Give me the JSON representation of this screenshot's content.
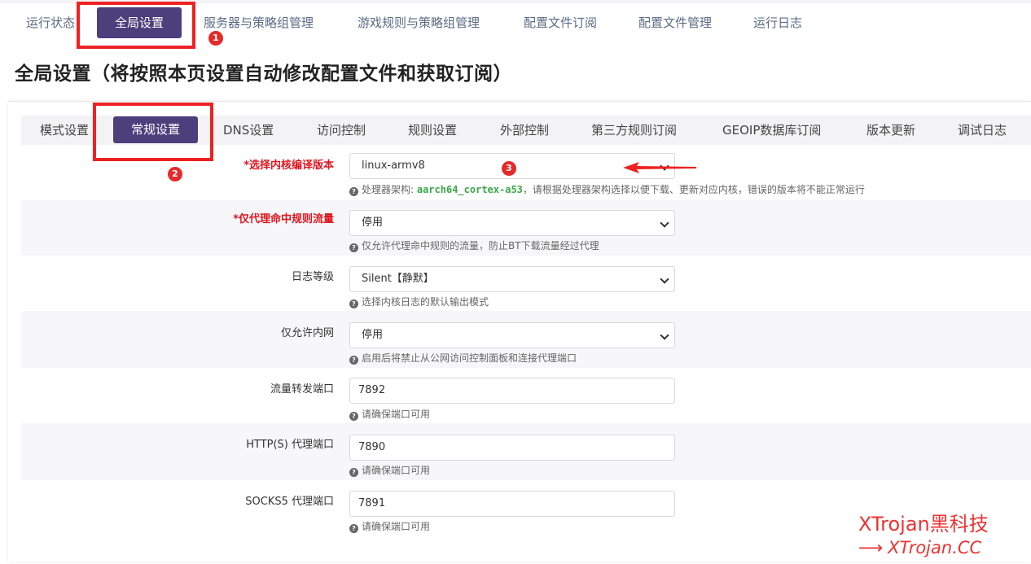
{
  "top_nav": {
    "tabs": [
      "运行状态",
      "全局设置",
      "服务器与策略组管理",
      "游戏规则与策略组管理",
      "配置文件订阅",
      "配置文件管理",
      "运行日志"
    ],
    "active": "全局设置"
  },
  "page_title": "全局设置（将按照本页设置自动修改配置文件和获取订阅）",
  "sub_nav": {
    "tabs": [
      "模式设置",
      "常规设置",
      "DNS设置",
      "访问控制",
      "规则设置",
      "外部控制",
      "第三方规则订阅",
      "GEOIP数据库订阅",
      "版本更新",
      "调试日志"
    ],
    "active": "常规设置"
  },
  "form": {
    "core_version": {
      "label": "*选择内核编译版本",
      "value": "linux-armv8",
      "help_prefix": "处理器架构: ",
      "help_arch": "aarch64_cortex-a53",
      "help_suffix": "，请根据处理器架构选择以便下载、更新对应内核，错误的版本将不能正常运行"
    },
    "proxy_rule_only": {
      "label": "*仅代理命中规则流量",
      "value": "停用",
      "help": "仅允许代理命中规则的流量，防止BT下载流量经过代理"
    },
    "log_level": {
      "label": "日志等级",
      "value": "Silent【静默】",
      "help": "选择内核日志的默认输出模式"
    },
    "lan_only": {
      "label": "仅允许内网",
      "value": "停用",
      "help": "启用后将禁止从公网访问控制面板和连接代理端口"
    },
    "redir_port": {
      "label": "流量转发端口",
      "value": "7892",
      "help": "请确保端口可用"
    },
    "http_port": {
      "label": "HTTP(S) 代理端口",
      "value": "7890",
      "help": "请确保端口可用"
    },
    "socks_port": {
      "label": "SOCKS5 代理端口",
      "value": "7891",
      "help": "请确保端口可用"
    }
  },
  "annotations": {
    "badge_1": "1",
    "badge_2": "2",
    "badge_3": "3",
    "color": "#ee2222"
  },
  "watermark": {
    "line1": "XTrojan黑科技",
    "line2": "XTrojan.CC",
    "arrow": "⟶"
  },
  "colors": {
    "accent": "#4b3f7c",
    "required": "#e0141e",
    "arch": "#3aa84a"
  }
}
